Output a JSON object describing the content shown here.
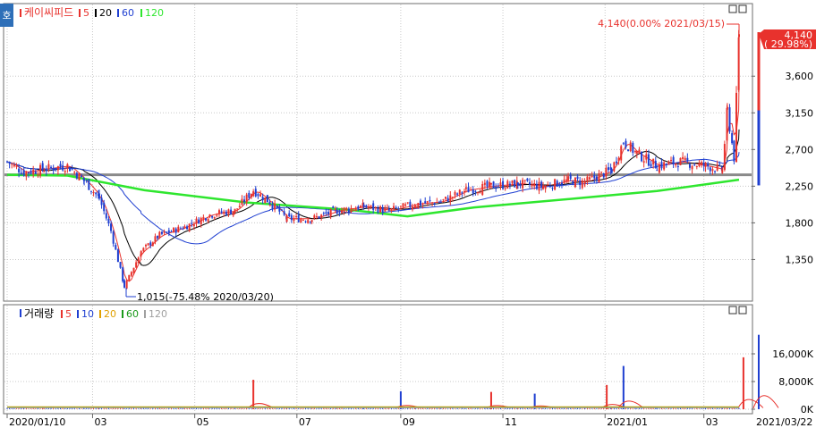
{
  "window": {
    "corner_label": "호"
  },
  "price_panel": {
    "stock_name": "케이씨피드",
    "ma_labels": [
      "5",
      "20",
      "60",
      "120"
    ],
    "y_ticks": [
      "3,600",
      "3,150",
      "2,700",
      "2,250",
      "1,800",
      "1,350"
    ],
    "current_price_label": "4,140",
    "current_change_label": "( 29.98%)",
    "high_annotation": "4,140(0.00% 2021/03/15)",
    "low_annotation": "1,015(-75.48% 2020/03/20)"
  },
  "volume_panel": {
    "title": "거래량",
    "ma_labels": [
      "5",
      "10",
      "20",
      "60",
      "120"
    ],
    "y_ticks": [
      "16,000K",
      "8,000K",
      "0K"
    ]
  },
  "x_axis": {
    "labels": [
      "2020/01/10",
      "03",
      "05",
      "07",
      "09",
      "11",
      "2021/01",
      "03"
    ],
    "end_label": "2021/03/22"
  },
  "colors": {
    "up": "#e8322d",
    "down": "#1f3fd1",
    "ma5": "#e8322d",
    "ma20": "#000000",
    "ma60": "#1f3fd1",
    "ma120": "#2ee62e",
    "ma10": "#1f3fd1",
    "ma20_vol": "#e0a000",
    "ma60_vol": "#1a9a1a",
    "ma120_vol": "#a0a0a0",
    "level_line": "#8a8a8a",
    "grid": "#c8c8c8"
  },
  "chart_data": {
    "type": "candlestick",
    "title": "케이씨피드",
    "ylim": [
      900,
      4250
    ],
    "y_ticks": [
      1350,
      1800,
      2250,
      2700,
      3150,
      3600
    ],
    "horizontal_level": 2390,
    "high": {
      "value": 4140,
      "change_pct": 0.0,
      "date": "2021/03/15"
    },
    "low": {
      "value": 1015,
      "change_pct": -75.48,
      "date": "2020/03/20"
    },
    "last": {
      "value": 4140,
      "change_pct": 29.98,
      "date": "2021/03/22"
    },
    "price_path": [
      {
        "date": "2020/01/10",
        "close": 2550
      },
      {
        "date": "2020/01/20",
        "close": 2420
      },
      {
        "date": "2020/02/01",
        "close": 2460
      },
      {
        "date": "2020/02/15",
        "close": 2500
      },
      {
        "date": "2020/02/25",
        "close": 2320
      },
      {
        "date": "2020/03/05",
        "close": 2100
      },
      {
        "date": "2020/03/12",
        "close": 1700
      },
      {
        "date": "2020/03/20",
        "close": 1015
      },
      {
        "date": "2020/03/30",
        "close": 1450
      },
      {
        "date": "2020/04/10",
        "close": 1650
      },
      {
        "date": "2020/04/25",
        "close": 1750
      },
      {
        "date": "2020/05/10",
        "close": 1900
      },
      {
        "date": "2020/05/25",
        "close": 1950
      },
      {
        "date": "2020/06/05",
        "close": 2200
      },
      {
        "date": "2020/06/15",
        "close": 2050
      },
      {
        "date": "2020/06/25",
        "close": 1850
      },
      {
        "date": "2020/07/10",
        "close": 1850
      },
      {
        "date": "2020/07/25",
        "close": 1950
      },
      {
        "date": "2020/08/10",
        "close": 2000
      },
      {
        "date": "2020/08/25",
        "close": 1950
      },
      {
        "date": "2020/09/10",
        "close": 2030
      },
      {
        "date": "2020/09/25",
        "close": 2060
      },
      {
        "date": "2020/10/10",
        "close": 2200
      },
      {
        "date": "2020/10/25",
        "close": 2250
      },
      {
        "date": "2020/11/10",
        "close": 2280
      },
      {
        "date": "2020/11/25",
        "close": 2250
      },
      {
        "date": "2020/12/10",
        "close": 2320
      },
      {
        "date": "2020/12/20",
        "close": 2300
      },
      {
        "date": "2021/01/05",
        "close": 2450
      },
      {
        "date": "2021/01/12",
        "close": 2800
      },
      {
        "date": "2021/01/20",
        "close": 2650
      },
      {
        "date": "2021/02/01",
        "close": 2500
      },
      {
        "date": "2021/02/15",
        "close": 2550
      },
      {
        "date": "2021/03/02",
        "close": 2500
      },
      {
        "date": "2021/03/12",
        "close": 2450
      },
      {
        "date": "2021/03/15",
        "close": 3180
      },
      {
        "date": "2021/03/19",
        "close": 2600
      },
      {
        "date": "2021/03/22",
        "close": 4140
      }
    ],
    "moving_averages": {
      "ma120": [
        {
          "date": "2020/01/10",
          "value": 2390
        },
        {
          "date": "2020/02/15",
          "value": 2380
        },
        {
          "date": "2020/04/01",
          "value": 2200
        },
        {
          "date": "2020/06/01",
          "value": 2050
        },
        {
          "date": "2020/08/01",
          "value": 1960
        },
        {
          "date": "2020/09/05",
          "value": 1880
        },
        {
          "date": "2020/10/15",
          "value": 1990
        },
        {
          "date": "2020/12/15",
          "value": 2100
        },
        {
          "date": "2021/02/01",
          "value": 2190
        },
        {
          "date": "2021/03/22",
          "value": 2330
        }
      ]
    },
    "volume": {
      "unit": "K",
      "ylim": [
        0,
        22000
      ],
      "y_ticks": [
        0,
        8000,
        16000
      ],
      "spikes": [
        {
          "date": "2020/06/05",
          "value": 8500
        },
        {
          "date": "2020/09/01",
          "value": 5200
        },
        {
          "date": "2020/10/25",
          "value": 5000
        },
        {
          "date": "2020/11/20",
          "value": 4500
        },
        {
          "date": "2021/01/02",
          "value": 7000
        },
        {
          "date": "2021/01/12",
          "value": 12500
        },
        {
          "date": "2021/03/15",
          "value": 15000
        },
        {
          "date": "2021/03/22",
          "value": 21500
        }
      ]
    }
  }
}
